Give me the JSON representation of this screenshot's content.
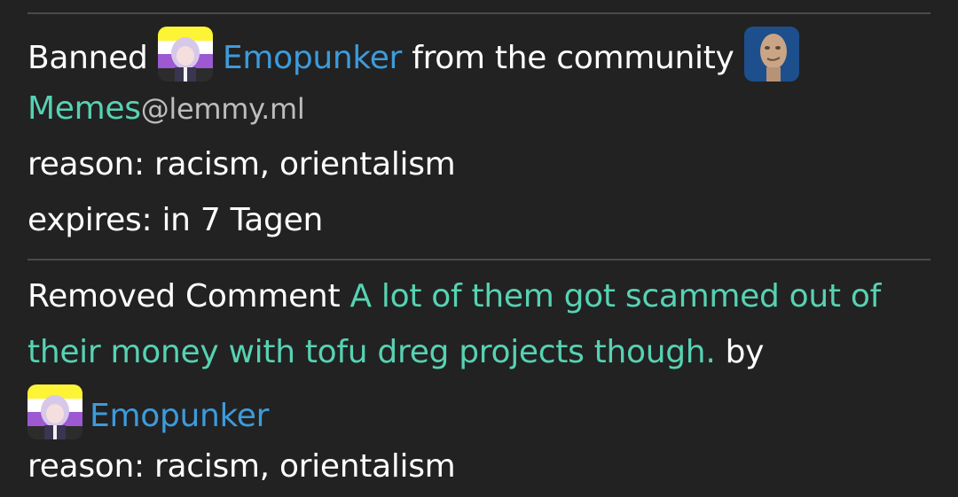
{
  "entries": [
    {
      "action_prefix": "Banned",
      "user": "Emopunker",
      "action_middle": "from the community",
      "community_name": "Memes",
      "community_instance": "@lemmy.ml",
      "reason": "reason: racism, orientalism",
      "expires": "expires: in 7 Tagen",
      "user_avatar_icon": "nonbinary-flag-anime-avatar",
      "community_icon": "meme-man-icon"
    },
    {
      "action_prefix": "Removed Comment",
      "comment_line1": "A lot of them got scammed out of",
      "comment_line2": "their money with tofu dreg projects though.",
      "by": "by",
      "user": "Emopunker",
      "reason": "reason: racism, orientalism",
      "user_avatar_icon": "nonbinary-flag-anime-avatar"
    }
  ],
  "colors": {
    "background": "#222222",
    "user_link": "#3d9bdc",
    "community_link": "#57d2b3",
    "instance_text": "#bdbdbd",
    "divider": "#4a4a4a"
  }
}
